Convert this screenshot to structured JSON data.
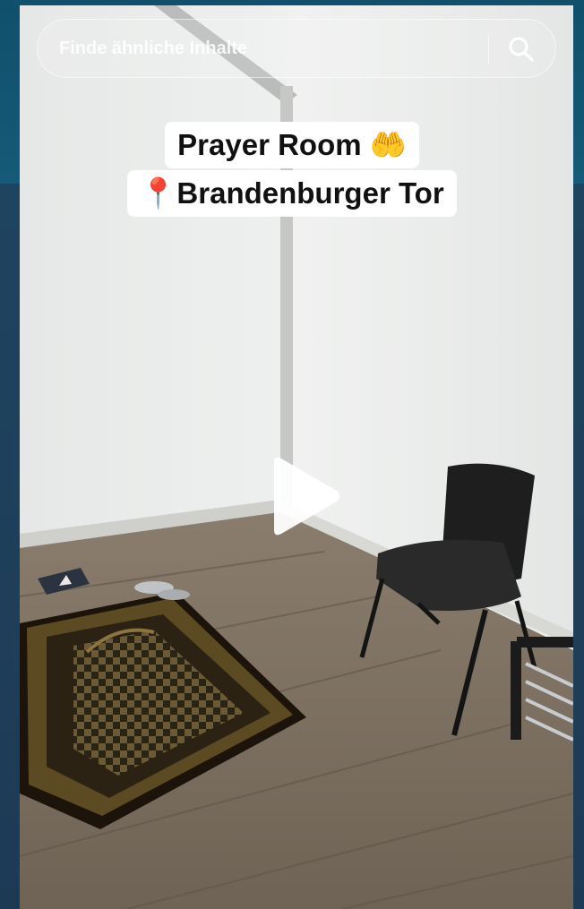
{
  "search": {
    "placeholder": "Finde ähnliche Inhalte"
  },
  "video": {
    "caption_line1": "Prayer Room 🤲",
    "caption_line2": "📍Brandenburger Tor"
  },
  "colors": {
    "background_top": "#10506c",
    "background_bottom": "#1d3a55"
  },
  "icons": {
    "search": "search-icon",
    "play": "play-icon"
  }
}
